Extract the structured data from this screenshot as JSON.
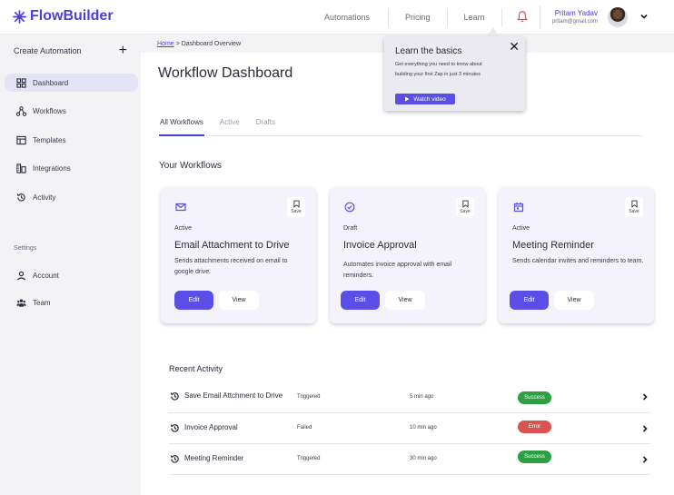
{
  "app": {
    "logo_text": "FlowBuilder",
    "accent": "#4a3fd9"
  },
  "topnav": {
    "items": [
      "Automations",
      "Pricing",
      "Learn"
    ]
  },
  "user": {
    "name": "Pritam Yadav",
    "email": "pritam@gmail.com"
  },
  "sidebar": {
    "create_label": "Create Automation",
    "items": [
      {
        "label": "Dashboard",
        "icon": "dashboard-icon",
        "active": true
      },
      {
        "label": "Workflows",
        "icon": "workflow-icon"
      },
      {
        "label": "Templates",
        "icon": "templates-icon"
      },
      {
        "label": "Integrations",
        "icon": "integrations-icon"
      },
      {
        "label": "Activity",
        "icon": "activity-icon"
      }
    ],
    "settings_label": "Settings",
    "settings_items": [
      {
        "label": "Account",
        "icon": "account-icon"
      },
      {
        "label": "Team",
        "icon": "team-icon"
      }
    ]
  },
  "breadcrumb": {
    "home": "Home",
    "current": "> Dashboard Overview"
  },
  "page": {
    "title": "Workflow Dashboard",
    "tabs": [
      "All Workflows",
      "Active",
      "Drafts"
    ],
    "section_title": "Your Workflows"
  },
  "cards": [
    {
      "status": "Active",
      "title": "Email Attachment to Drive",
      "desc": "Sends attachments received on email to google drive.",
      "save": "Save",
      "edit": "Edit",
      "view": "View",
      "icon": "mail-icon"
    },
    {
      "status": "Draft",
      "title": "Invoice Approval",
      "desc": "Automates invoice approval with email reminders.",
      "save": "Save",
      "edit": "Edit",
      "view": "View",
      "icon": "check-circle-icon"
    },
    {
      "status": "Active",
      "title": "Meeting Reminder",
      "desc": "Sends calendar invites and reminders to team.",
      "save": "Save",
      "edit": "Edit",
      "view": "View",
      "icon": "calendar-icon"
    }
  ],
  "recent": {
    "title": "Recent Activity",
    "rows": [
      {
        "name": "Save Email Attchment to Drive",
        "status": "Triggered",
        "time": "5 min ago",
        "result": "Success",
        "color": "#2ea043"
      },
      {
        "name": "Invoice Approval",
        "status": "Failed",
        "time": "10 min ago",
        "result": "Error",
        "color": "#d9534f"
      },
      {
        "name": "Meeting Reminder",
        "status": "Triggered",
        "time": "30 min ago",
        "result": "Success",
        "color": "#2ea043"
      }
    ]
  },
  "popup": {
    "title": "Learn the basics",
    "text": "Get everything you need to know about building your first Zap in just 3 minutes",
    "button": "Watch video",
    "close": "✕"
  }
}
